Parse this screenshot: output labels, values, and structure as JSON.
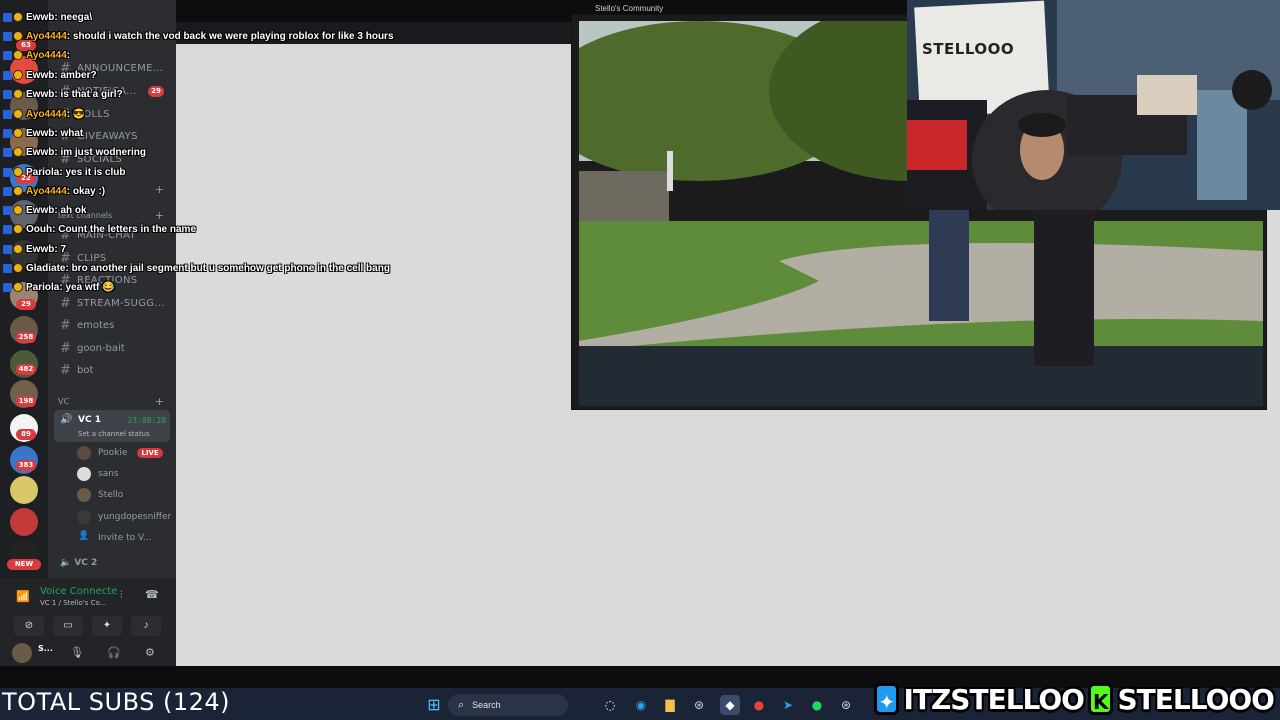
{
  "chat": {
    "messages": [
      {
        "user": "Ewwb",
        "text": ": neega\\",
        "color": "#ffffff"
      },
      {
        "user": "Ayo4444",
        "text": ": should i watch the vod back we were playing roblox for like 3 hours",
        "color": "#ffb31a"
      },
      {
        "user": "Ayo4444",
        "text": ":",
        "color": "#ffb31a"
      },
      {
        "user": "Ewwb",
        "text": ": amber?",
        "color": "#ffffff"
      },
      {
        "user": "Ewwb",
        "text": ": is that a girl?",
        "color": "#ffffff"
      },
      {
        "user": "Ayo4444",
        "text": ": 😎",
        "color": "#ffb31a"
      },
      {
        "user": "Ewwb",
        "text": ": what",
        "color": "#ffffff"
      },
      {
        "user": "Ewwb",
        "text": ": im just wodnering",
        "color": "#ffffff"
      },
      {
        "user": "Pariola",
        "text": ": yes it is club",
        "color": "#ffffff"
      },
      {
        "user": "Ayo4444",
        "text": ": okay :)",
        "color": "#ffb31a"
      },
      {
        "user": "Ewwb",
        "text": ": ah ok",
        "color": "#ffffff"
      },
      {
        "user": "Oouh",
        "text": ": Count the letters in the name",
        "color": "#ffffff"
      },
      {
        "user": "Ewwb",
        "text": ": 7",
        "color": "#ffffff"
      },
      {
        "user": "Gladiate",
        "text": ": bro another jail segment but u somehow get phone in the cell bang",
        "color": "#ffffff"
      },
      {
        "user": "Pariola",
        "text": ": yea wtf 😂",
        "color": "#ffffff"
      }
    ]
  },
  "sidebar": {
    "channels": [
      {
        "name": "ANNOUNCEME..."
      },
      {
        "name": "NOTIFICA..."
      },
      {
        "name": "POLLS"
      },
      {
        "name": "GIVEAWAYS"
      },
      {
        "name": "SOCIALS"
      },
      {
        "name": "MAIN-CHAT"
      },
      {
        "name": "CLIPS"
      },
      {
        "name": "REACTIONS"
      },
      {
        "name": "STREAM-SUGG..."
      },
      {
        "name": "emotes"
      },
      {
        "name": "goon-bait"
      },
      {
        "name": "bot"
      }
    ],
    "notif_badge": "29",
    "text_channels_label": "text channels",
    "vc_category": "VC",
    "vc1": {
      "name": "VC 1",
      "timer": "23:08:28",
      "status": "Set a channel status"
    },
    "members": [
      {
        "name": "Pookie",
        "live": "LIVE"
      },
      {
        "name": "sans"
      },
      {
        "name": "Stello"
      },
      {
        "name": "yungdopesniffer"
      },
      {
        "name": "Invite to V..."
      }
    ],
    "vc2": "VC 2"
  },
  "rail": {
    "badges": [
      "63",
      "29",
      "22",
      "258",
      "482",
      "198",
      "89",
      "383"
    ],
    "new_label": "NEW"
  },
  "voice_panel": {
    "connected": "Voice Connecte",
    "location": "VC 1 / Stello's Co...",
    "username": "S..."
  },
  "stream": {
    "window_title": "Stello's Community",
    "cam_sign": "STELLOOO"
  },
  "taskbar": {
    "search_placeholder": "Search",
    "subs_text": "TOTAL SUBS (124)"
  },
  "socials": {
    "twitter": "ITZSTELLOO",
    "kick": "STELLOOO"
  },
  "colors": {
    "discord_green": "#23a55a",
    "twitter_blue": "#1d9bf0",
    "kick_green": "#53fc18",
    "badge_red": "#d83c3e"
  }
}
